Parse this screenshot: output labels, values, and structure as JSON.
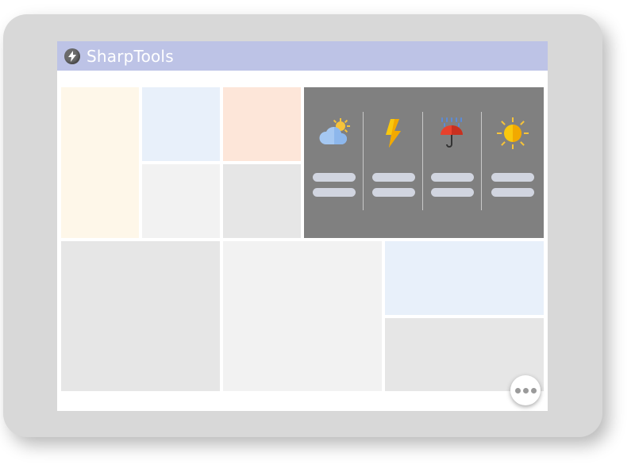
{
  "app": {
    "title": "SharpTools"
  },
  "colors": {
    "header": "#bdc3e6",
    "tile_cream": "#fef7e9",
    "tile_blue": "#e8f0fa",
    "tile_peach": "#fde6d9",
    "tile_light": "#f2f2f2",
    "tile_gray": "#e6e6e6",
    "weather_bg": "#808080"
  },
  "weather": {
    "columns": [
      {
        "icon": "partly-cloudy-icon"
      },
      {
        "icon": "lightning-icon"
      },
      {
        "icon": "rain-umbrella-icon"
      },
      {
        "icon": "sun-icon"
      }
    ]
  },
  "fab": {
    "icon": "more-dots-icon"
  }
}
